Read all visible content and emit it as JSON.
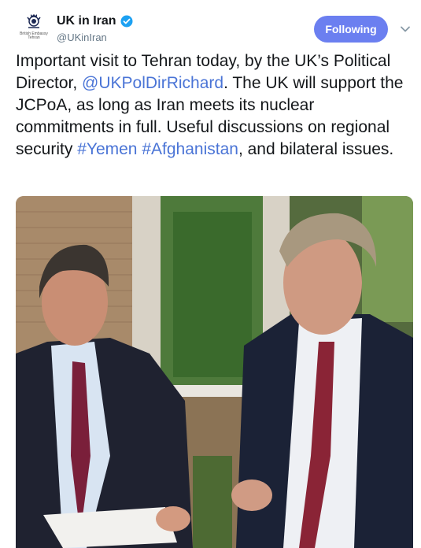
{
  "account": {
    "display_name": "UK in Iran",
    "handle": "@UKinIran",
    "avatar_caption": "British Embassy\nTehran",
    "verified": true
  },
  "follow_button": {
    "label": "Following",
    "color": "#6b7ff0"
  },
  "tweet": {
    "segments": [
      {
        "text": "Important visit to Tehran today, by the UK’s Political Director, ",
        "link": false
      },
      {
        "text": "@UKPolDirRichard",
        "link": true
      },
      {
        "text": ". The UK will support the JCPoA, as long as Iran meets its nuclear commitments in full. Useful discussions on regional security ",
        "link": false
      },
      {
        "text": "#Yemen",
        "link": true
      },
      {
        "text": " ",
        "link": false
      },
      {
        "text": "#Afghanistan",
        "link": true
      },
      {
        "text": ", and bilateral issues.",
        "link": false
      }
    ],
    "link_color": "#4a74d6"
  },
  "media": {
    "icon": "photo-icon"
  },
  "icons": {
    "avatar": "royal-crest-icon",
    "verified": "verified-badge-icon",
    "menu": "chevron-down-icon"
  }
}
